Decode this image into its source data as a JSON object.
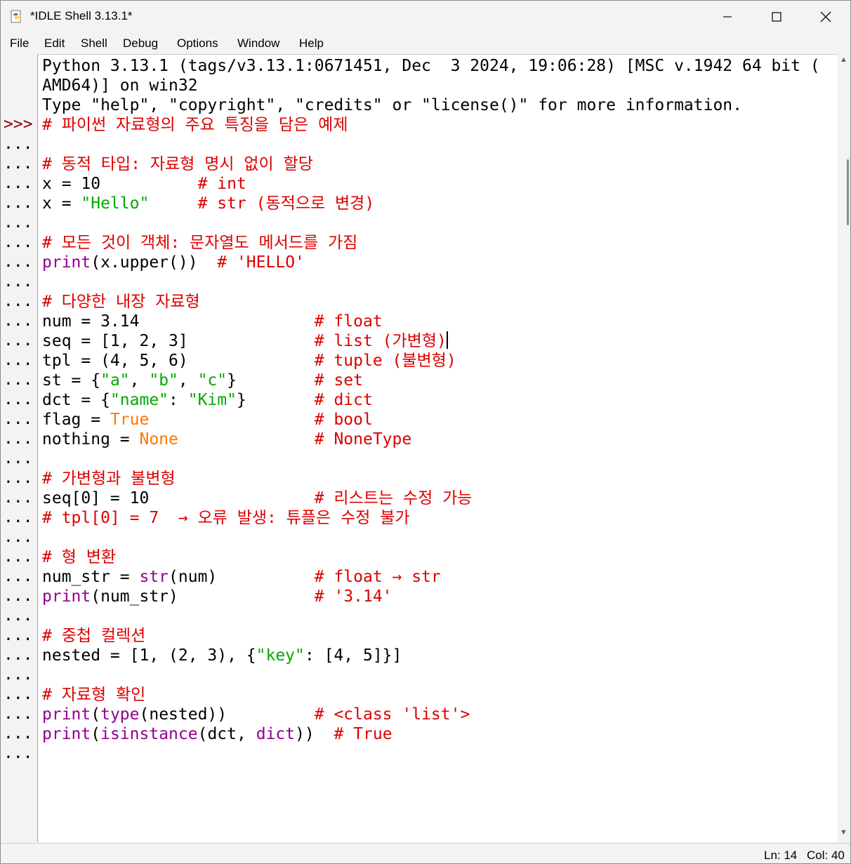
{
  "window": {
    "title": "*IDLE Shell 3.13.1*",
    "controls": {
      "minimize": "─",
      "maximize": "☐",
      "close": "✕"
    }
  },
  "menu": [
    "File",
    "Edit",
    "Shell",
    "Debug",
    "Options",
    "Window",
    "Help"
  ],
  "colors": {
    "comment": "#dd0000",
    "string": "#00aa00",
    "builtin": "#900090",
    "keyword": "#ff7700",
    "prompt": "#8b0000"
  },
  "gutter": {
    "main_prompt": ">>>",
    "continuation": "...",
    "continuation_count": 33
  },
  "banner": [
    "Python 3.13.1 (tags/v3.13.1:0671451, Dec  3 2024, 19:06:28) [MSC v.1942 64 bit (",
    "AMD64)] on win32",
    "Type \"help\", \"copyright\", \"credits\" or \"license()\" for more information."
  ],
  "code_lines": [
    [
      {
        "t": "# 파이썬 자료형의 주요 특징을 담은 예제",
        "c": "com"
      }
    ],
    [],
    [
      {
        "t": "# 동적 타입: 자료형 명시 없이 할당",
        "c": "com"
      }
    ],
    [
      {
        "t": "x = 10          "
      },
      {
        "t": "# int",
        "c": "com"
      }
    ],
    [
      {
        "t": "x = "
      },
      {
        "t": "\"Hello\"",
        "c": "str"
      },
      {
        "t": "     "
      },
      {
        "t": "# str (동적으로 변경)",
        "c": "com"
      }
    ],
    [],
    [
      {
        "t": "# 모든 것이 객체: 문자열도 메서드를 가짐",
        "c": "com"
      }
    ],
    [
      {
        "t": "print",
        "c": "bi"
      },
      {
        "t": "(x.upper())  "
      },
      {
        "t": "# 'HELLO'",
        "c": "com"
      }
    ],
    [],
    [
      {
        "t": "# 다양한 내장 자료형",
        "c": "com"
      }
    ],
    [
      {
        "t": "num = 3.14                  "
      },
      {
        "t": "# float",
        "c": "com"
      }
    ],
    [
      {
        "t": "seq = [1, 2, 3]             "
      },
      {
        "t": "# list (가변형)",
        "c": "com"
      },
      {
        "caret": true
      }
    ],
    [
      {
        "t": "tpl = (4, 5, 6)             "
      },
      {
        "t": "# tuple (불변형)",
        "c": "com"
      }
    ],
    [
      {
        "t": "st = {"
      },
      {
        "t": "\"a\"",
        "c": "str"
      },
      {
        "t": ", "
      },
      {
        "t": "\"b\"",
        "c": "str"
      },
      {
        "t": ", "
      },
      {
        "t": "\"c\"",
        "c": "str"
      },
      {
        "t": "}        "
      },
      {
        "t": "# set",
        "c": "com"
      }
    ],
    [
      {
        "t": "dct = {"
      },
      {
        "t": "\"name\"",
        "c": "str"
      },
      {
        "t": ": "
      },
      {
        "t": "\"Kim\"",
        "c": "str"
      },
      {
        "t": "}       "
      },
      {
        "t": "# dict",
        "c": "com"
      }
    ],
    [
      {
        "t": "flag = "
      },
      {
        "t": "True",
        "c": "kw"
      },
      {
        "t": "                 "
      },
      {
        "t": "# bool",
        "c": "com"
      }
    ],
    [
      {
        "t": "nothing = "
      },
      {
        "t": "None",
        "c": "kw"
      },
      {
        "t": "              "
      },
      {
        "t": "# NoneType",
        "c": "com"
      }
    ],
    [],
    [
      {
        "t": "# 가변형과 불변형",
        "c": "com"
      }
    ],
    [
      {
        "t": "seq[0] = 10                 "
      },
      {
        "t": "# 리스트는 수정 가능",
        "c": "com"
      }
    ],
    [
      {
        "t": "# tpl[0] = 7  → 오류 발생: 튜플은 수정 불가",
        "c": "com"
      }
    ],
    [],
    [
      {
        "t": "# 형 변환",
        "c": "com"
      }
    ],
    [
      {
        "t": "num_str = "
      },
      {
        "t": "str",
        "c": "bi"
      },
      {
        "t": "(num)          "
      },
      {
        "t": "# float → str",
        "c": "com"
      }
    ],
    [
      {
        "t": "print",
        "c": "bi"
      },
      {
        "t": "(num_str)              "
      },
      {
        "t": "# '3.14'",
        "c": "com"
      }
    ],
    [],
    [
      {
        "t": "# 중첩 컬렉션",
        "c": "com"
      }
    ],
    [
      {
        "t": "nested = [1, (2, 3), {"
      },
      {
        "t": "\"key\"",
        "c": "str"
      },
      {
        "t": ": [4, 5]}]"
      }
    ],
    [],
    [
      {
        "t": "# 자료형 확인",
        "c": "com"
      }
    ],
    [
      {
        "t": "print",
        "c": "bi"
      },
      {
        "t": "("
      },
      {
        "t": "type",
        "c": "bi"
      },
      {
        "t": "(nested))         "
      },
      {
        "t": "# <class 'list'>",
        "c": "com"
      }
    ],
    [
      {
        "t": "print",
        "c": "bi"
      },
      {
        "t": "("
      },
      {
        "t": "isinstance",
        "c": "bi"
      },
      {
        "t": "(dct, "
      },
      {
        "t": "dict",
        "c": "bi"
      },
      {
        "t": "))  "
      },
      {
        "t": "# True",
        "c": "com"
      }
    ],
    []
  ],
  "status": {
    "ln": "Ln: 14",
    "col": "Col: 40"
  }
}
